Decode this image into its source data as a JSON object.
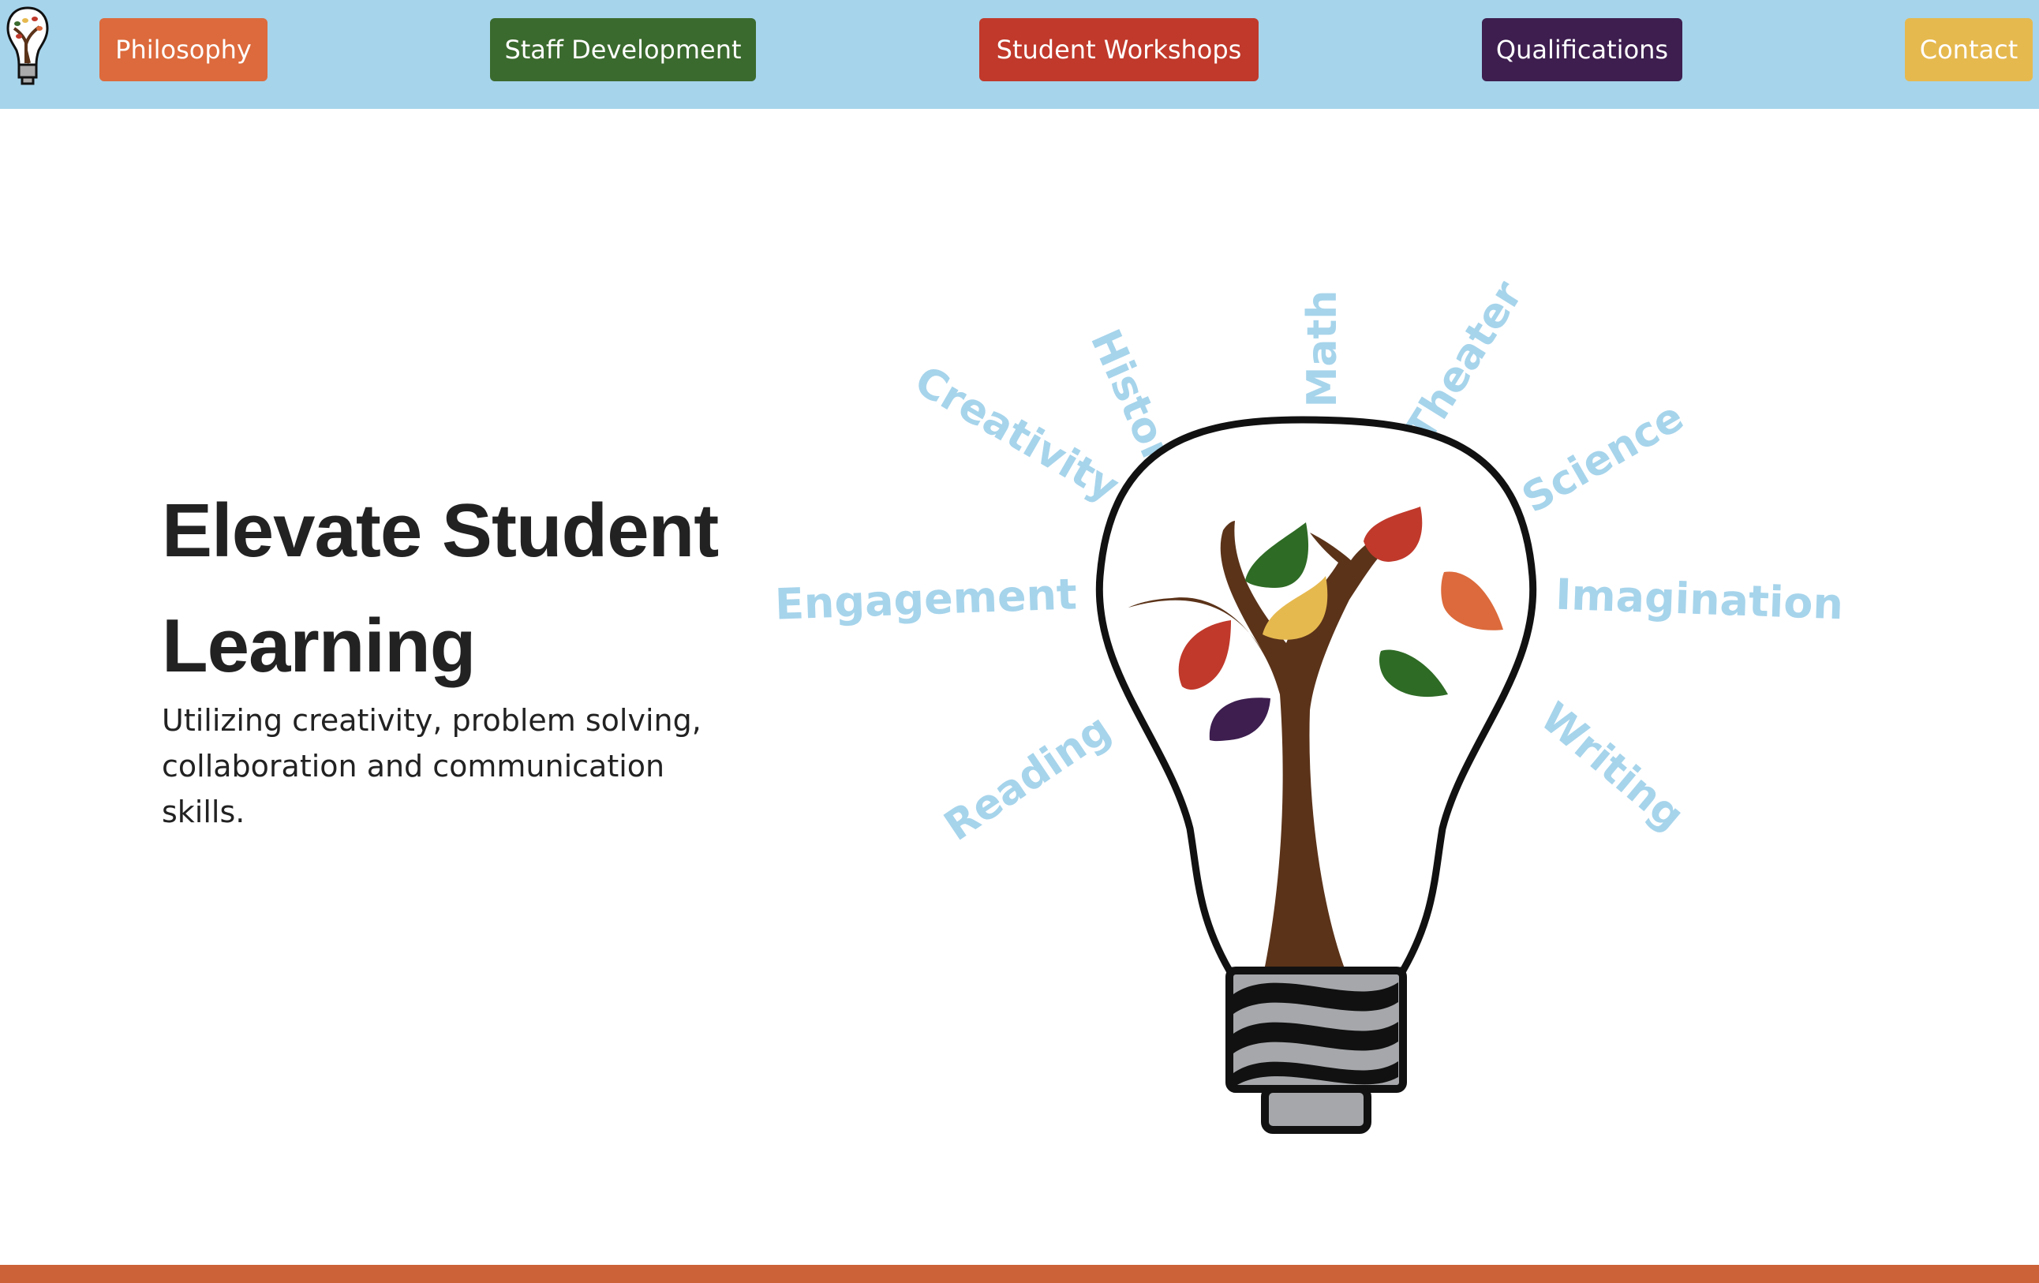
{
  "colors": {
    "topbar": "#a6d4eb",
    "philosophy": "#dc6a3c",
    "staff_development": "#3b6a2e",
    "student_workshops": "#c0392b",
    "qualifications": "#3d1e4f",
    "contact": "#e6b94f",
    "footer": "#cc6338",
    "subject_text": "#a6d4eb"
  },
  "nav": {
    "philosophy": "Philosophy",
    "staff_development": "Staff Development",
    "student_workshops": "Student Workshops",
    "qualifications": "Qualifications",
    "contact": "Contact"
  },
  "hero": {
    "title_line1": "Elevate Student",
    "title_line2": "Learning",
    "subtitle": "Utilizing creativity, problem solving, collaboration and communication skills."
  },
  "illustration": {
    "subjects": {
      "history": "History",
      "math": "Math",
      "theater": "Theater",
      "creativity": "Creativity",
      "science": "Science",
      "engagement": "Engagement",
      "imagination": "Imagination",
      "reading": "Reading",
      "writing": "Writing"
    }
  }
}
